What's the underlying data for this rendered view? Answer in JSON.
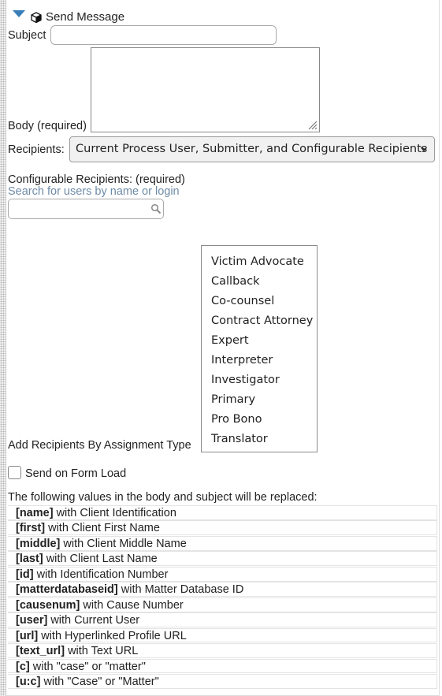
{
  "header": {
    "title": "Send Message"
  },
  "form": {
    "subject_label": "Subject",
    "subject_value": "",
    "body_label": "Body",
    "body_required": "(required)",
    "body_value": "",
    "recipients_label": "Recipients:",
    "recipients_selected": "Current Process User, Submitter, and Configurable Recipients",
    "configurable_label": "Configurable Recipients: (required)",
    "search_link": "Search for users by name or login",
    "search_value": "",
    "assignment_label": "Add Recipients By Assignment Type",
    "assignment_types": [
      "Victim Advocate",
      "Callback",
      "Co-counsel",
      "Contract Attorney",
      "Expert",
      "Interpreter",
      "Investigator",
      "Primary",
      "Pro Bono",
      "Translator"
    ],
    "send_on_load_label": "Send on Form Load",
    "send_on_load_checked": false
  },
  "replacements": {
    "intro": "The following values in the body and subject will be replaced:",
    "items": [
      {
        "token": "[name]",
        "desc": "with Client Identification"
      },
      {
        "token": "[first]",
        "desc": "with Client First Name"
      },
      {
        "token": "[middle]",
        "desc": "with Client Middle Name"
      },
      {
        "token": "[last]",
        "desc": "with Client Last Name"
      },
      {
        "token": "[id]",
        "desc": "with Identification Number"
      },
      {
        "token": "[matterdatabaseid]",
        "desc": "with Matter Database ID"
      },
      {
        "token": "[causenum]",
        "desc": "with Cause Number"
      },
      {
        "token": "[user]",
        "desc": "with Current User"
      },
      {
        "token": "[url]",
        "desc": "with Hyperlinked Profile URL"
      },
      {
        "token": "[text_url]",
        "desc": "with Text URL"
      },
      {
        "token": "[c]",
        "desc": "with \"case\" or \"matter\""
      },
      {
        "token": "[u:c]",
        "desc": "with \"Case\" or \"Matter\""
      }
    ]
  },
  "colors": {
    "accent": "#3a7fb8",
    "link": "#6f8ca8"
  },
  "icons": [
    "collapse-caret-icon",
    "cube-icon",
    "resize-grip-icon",
    "chevron-down-icon",
    "magnifier-icon"
  ]
}
